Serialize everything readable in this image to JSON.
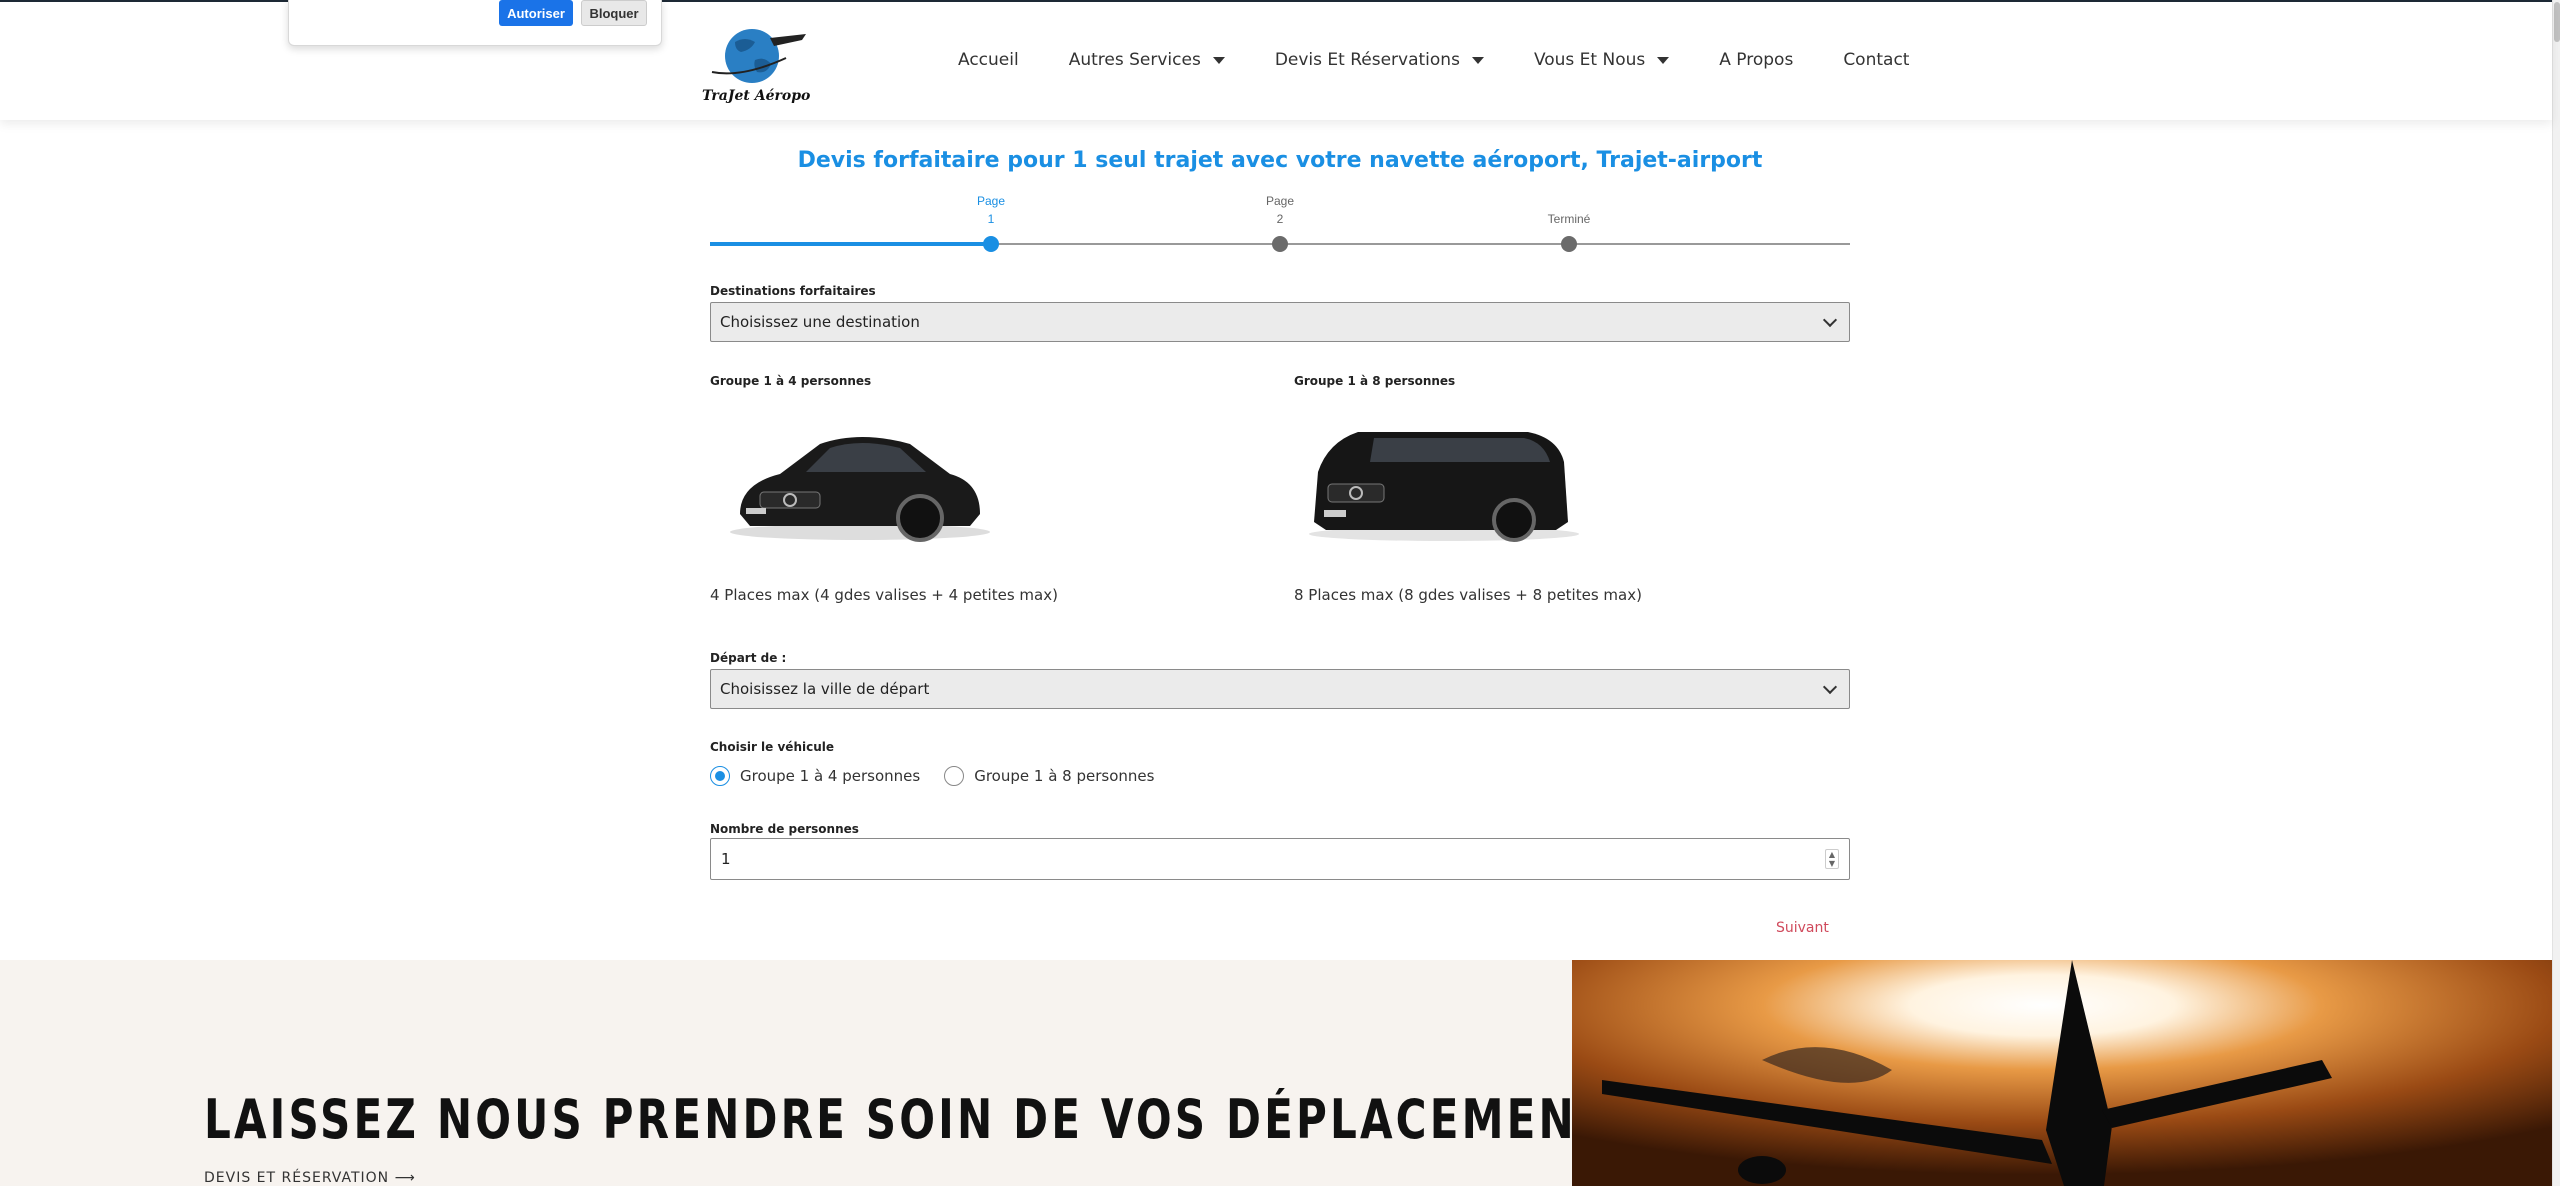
{
  "permission_prompt": {
    "allow_label": "Autoriser",
    "block_label": "Bloquer"
  },
  "header": {
    "logo_text": "TraJet Aéroport",
    "nav": [
      {
        "label": "Accueil",
        "has_dropdown": false
      },
      {
        "label": "Autres Services",
        "has_dropdown": true
      },
      {
        "label": "Devis Et Réservations",
        "has_dropdown": true
      },
      {
        "label": "Vous Et Nous",
        "has_dropdown": true
      },
      {
        "label": "A Propos",
        "has_dropdown": false
      },
      {
        "label": "Contact",
        "has_dropdown": false
      }
    ]
  },
  "form": {
    "title": "Devis forfaitaire pour 1 seul trajet avec votre navette aéroport, Trajet-airport",
    "steps": [
      {
        "line1": "Page",
        "line2": "1",
        "active": true
      },
      {
        "line1": "Page",
        "line2": "2",
        "active": false
      },
      {
        "line1": "",
        "line2": "Terminé",
        "active": false
      }
    ],
    "progress": 0.25,
    "destinations": {
      "label": "Destinations forfaitaires",
      "value": "Choisissez une destination"
    },
    "vehicles": [
      {
        "label": "Groupe 1 à 4 personnes",
        "caption": "4 Places max (4 gdes valises + 4 petites max)",
        "icon": "sedan-car-image"
      },
      {
        "label": "Groupe 1 à 8 personnes",
        "caption": "8 Places max (8 gdes valises + 8 petites max)",
        "icon": "van-image"
      }
    ],
    "depart": {
      "label": "Départ de :",
      "value": "Choisissez la ville de départ"
    },
    "vehicle_choice": {
      "label": "Choisir le véhicule",
      "options": [
        {
          "label": "Groupe 1 à 4 personnes",
          "checked": true
        },
        {
          "label": "Groupe 1 à 8 personnes",
          "checked": false
        }
      ]
    },
    "persons": {
      "label": "Nombre de personnes",
      "value": "1"
    },
    "next_label": "Suivant"
  },
  "hero": {
    "title": "LAISSEZ NOUS PRENDRE SOIN DE VOS DÉPLACEMENTS",
    "link": "DEVIS ET RÉSERVATION ⟶"
  },
  "colors": {
    "accent": "#1a8fe3",
    "next": "#d04a5c",
    "hero_bg": "#f7f3ef"
  }
}
